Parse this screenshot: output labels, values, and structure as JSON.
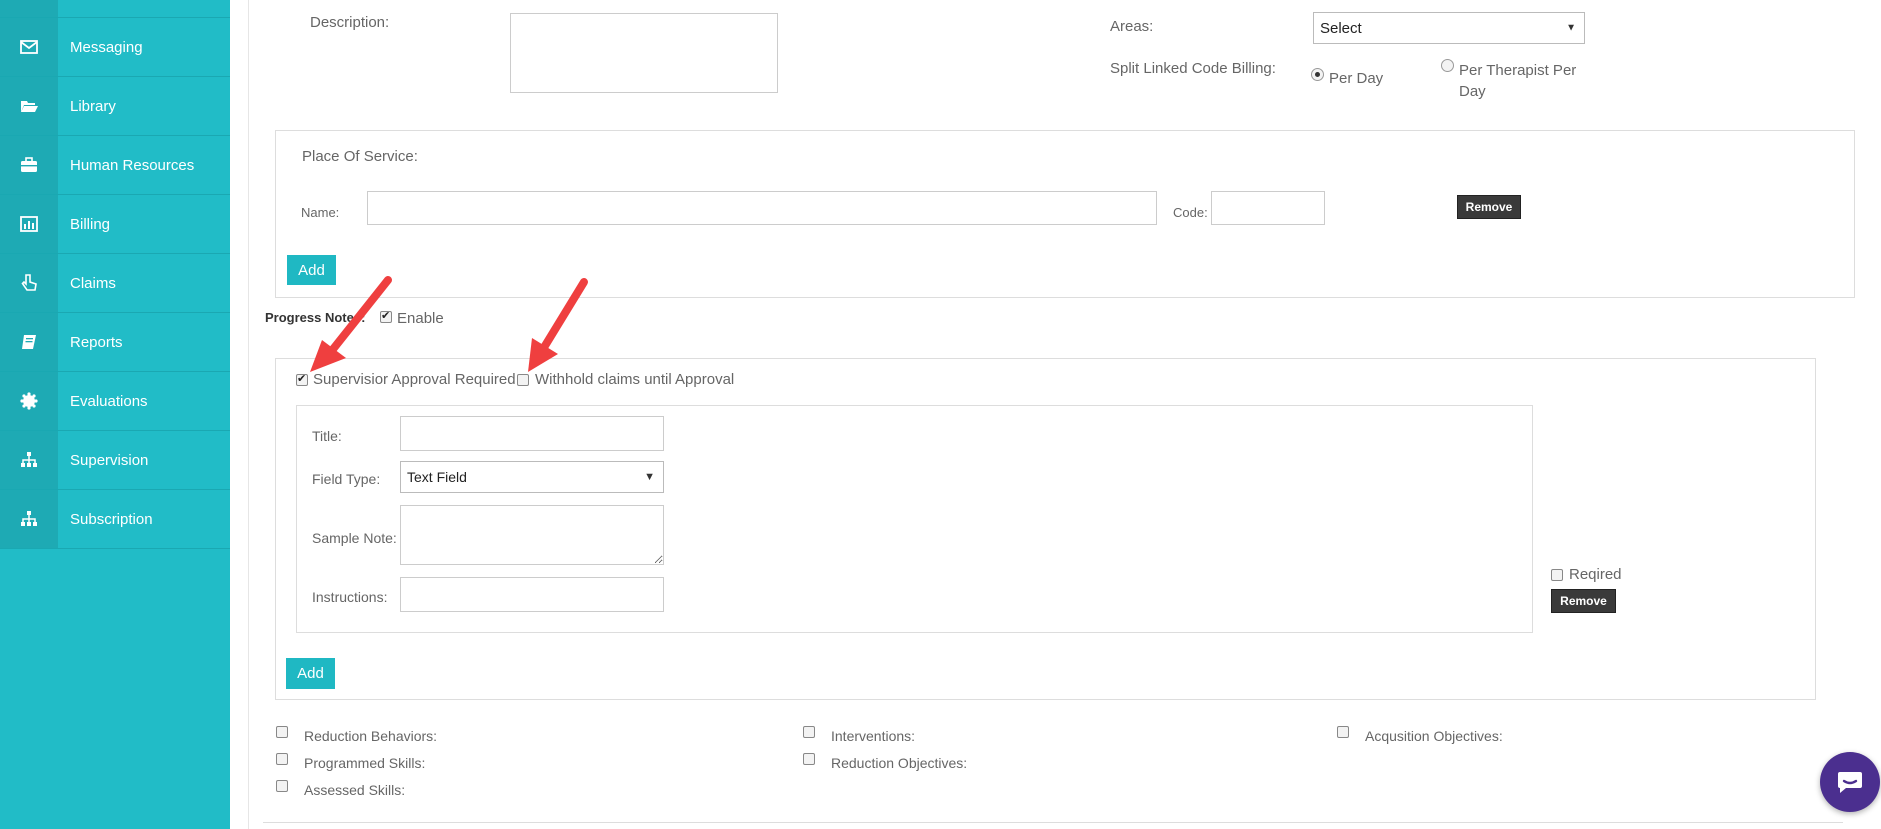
{
  "sidebar": {
    "items": [
      {
        "label": "Messaging",
        "icon": "envelope-icon"
      },
      {
        "label": "Library",
        "icon": "folder-open-icon"
      },
      {
        "label": "Human Resources",
        "icon": "briefcase-icon"
      },
      {
        "label": "Billing",
        "icon": "bar-chart-icon"
      },
      {
        "label": "Claims",
        "icon": "hand-pointer-icon"
      },
      {
        "label": "Reports",
        "icon": "book-icon"
      },
      {
        "label": "Evaluations",
        "icon": "certificate-icon"
      },
      {
        "label": "Supervision",
        "icon": "sitemap-icon"
      },
      {
        "label": "Subscription",
        "icon": "sitemap-icon"
      }
    ]
  },
  "form": {
    "description_label": "Description:",
    "areas_label": "Areas:",
    "areas_value": "Select",
    "split_label": "Split Linked Code Billing:",
    "split_options": [
      "Per Day",
      "Per Therapist Per Day"
    ],
    "split_selected": "Per Day"
  },
  "place_of_service": {
    "title": "Place Of Service:",
    "name_label": "Name:",
    "code_label": "Code:",
    "remove_label": "Remove",
    "add_label": "Add"
  },
  "progress_notes": {
    "label": "Progress Notes:",
    "enable_label": "Enable",
    "supervisor_label": "Supervisior Approval Required",
    "withhold_label": "Withhold claims until Approval",
    "title_label": "Title:",
    "field_type_label": "Field Type:",
    "field_type_value": "Text Field",
    "sample_note_label": "Sample Note:",
    "instructions_label": "Instructions:",
    "required_label": "Reqired",
    "remove_label": "Remove",
    "add_label": "Add"
  },
  "options": {
    "reduction_behaviors": "Reduction Behaviors:",
    "programmed_skills": "Programmed Skills:",
    "assessed_skills": "Assessed Skills:",
    "interventions": "Interventions:",
    "reduction_objectives": "Reduction Objectives:",
    "acquisition_objectives": "Acqusition Objectives:"
  },
  "colors": {
    "sidebar": "#21bcc7",
    "accent": "#1fb8c3",
    "arrow": "#ef3f3f",
    "chat": "#4b2f8f"
  }
}
